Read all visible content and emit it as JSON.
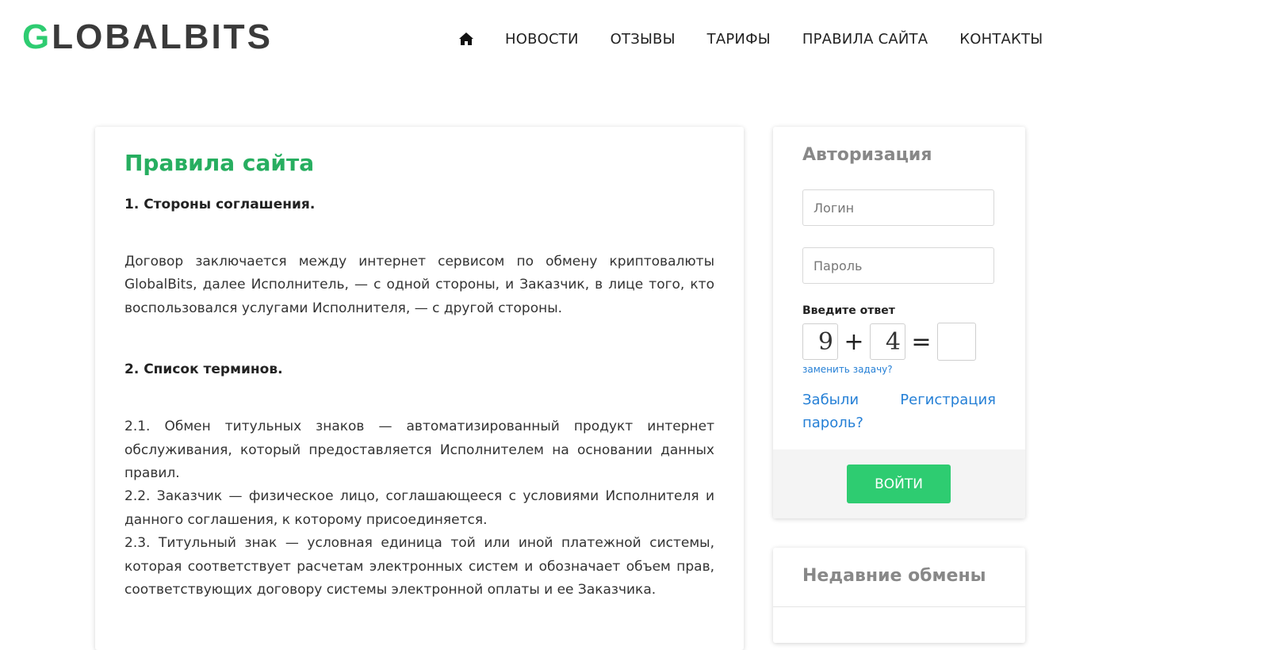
{
  "header": {
    "logo_first": "G",
    "logo_rest": "LOBALBITS",
    "home_icon": "home-icon",
    "nav": [
      "НОВОСТИ",
      "ОТЗЫВЫ",
      "ТАРИФЫ",
      "ПРАВИЛА САЙТА",
      "КОНТАКТЫ"
    ]
  },
  "main": {
    "title": "Правила сайта",
    "section1_heading": "1. Стороны соглашения.",
    "section1_text": "Договор заключается между интернет сервисом по обмену криптовалюты GlobalBits, далее Исполнитель, — с одной стороны, и Заказчик, в лице того, кто воспользовался услугами Исполнителя, — с другой стороны.",
    "section2_heading": "2. Список терминов.",
    "terms": [
      "2.1. Обмен титульных знаков — автоматизированный продукт интернет обслуживания, который предоставляется Исполнителем на основании данных правил.",
      "2.2. Заказчик — физическое лицо, соглашающееся с условиями Исполнителя и данного соглашения, к которому присоединяется.",
      "2.3. Титульный знак — условная единица той или иной платежной системы, которая соответствует расчетам электронных систем и обозначает объем прав, соответствующих договору системы электронной оплаты и ее Заказчика."
    ]
  },
  "auth": {
    "title": "Авторизация",
    "login_placeholder": "Логин",
    "password_placeholder": "Пароль",
    "captcha_label": "Введите ответ",
    "captcha_a": "9",
    "captcha_op": "+",
    "captcha_b": "4",
    "captcha_eq": "=",
    "captcha_answer": "",
    "replace_link": "заменить задачу?",
    "forgot_link": "Забыли пароль?",
    "register_link": "Регистрация",
    "login_button": "ВОЙТИ"
  },
  "recent": {
    "title": "Недавние обмены"
  },
  "colors": {
    "accent_green": "#2ecc71",
    "title_green": "#27ae60",
    "link_blue": "#2680d6"
  }
}
